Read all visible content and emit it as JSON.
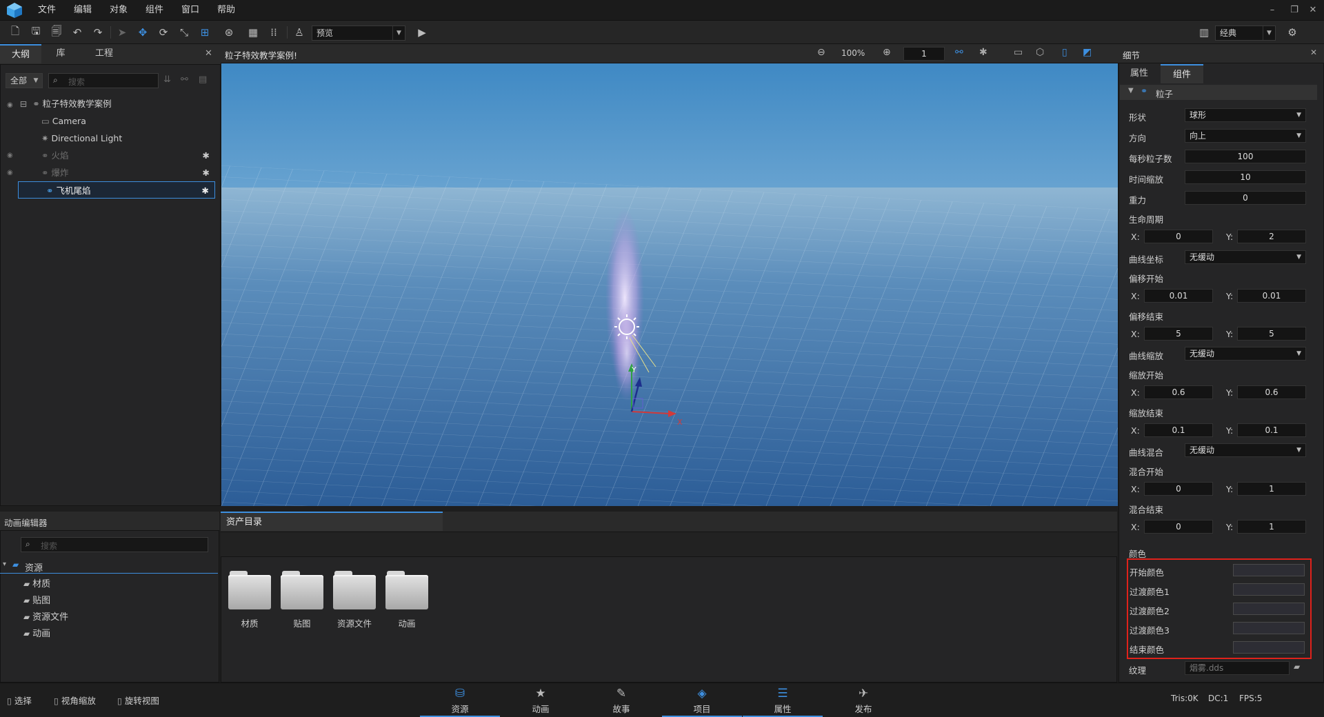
{
  "menu": [
    "文件",
    "编辑",
    "对象",
    "组件",
    "窗口",
    "帮助"
  ],
  "toolbar": {
    "view_mode": "预览",
    "layout": "经典"
  },
  "outline": {
    "tabs": [
      "大纲",
      "库",
      "工程"
    ],
    "filter": "全部",
    "search_placeholder": "搜索",
    "items": [
      {
        "label": "粒子特效教学案例"
      },
      {
        "label": "Camera"
      },
      {
        "label": "Directional Light"
      },
      {
        "label": "火焰"
      },
      {
        "label": "爆炸"
      },
      {
        "label": "飞机尾焰"
      }
    ]
  },
  "viewport": {
    "title": "粒子特效教学案例!",
    "zoom": "100%",
    "frame": "1"
  },
  "gizmo": {
    "x": "X",
    "y": "Y"
  },
  "anim_editor": {
    "title": "动画编辑器",
    "search_placeholder": "搜索",
    "root": "资源",
    "children": [
      "材质",
      "贴图",
      "资源文件",
      "动画"
    ]
  },
  "assets": {
    "tab": "资产目录",
    "folders": [
      "材质",
      "贴图",
      "资源文件",
      "动画"
    ]
  },
  "details": {
    "title": "细节",
    "tabs": [
      "属性",
      "组件"
    ],
    "section": "粒子",
    "shape_label": "形状",
    "shape_value": "球形",
    "direction_label": "方向",
    "direction_value": "向上",
    "rate_label": "每秒粒子数",
    "rate_value": "100",
    "timescale_label": "时间缩放",
    "timescale_value": "10",
    "gravity_label": "重力",
    "gravity_value": "0",
    "lifetime_label": "生命周期",
    "lifetime_x": "0",
    "lifetime_y": "2",
    "curve_coord_label": "曲线坐标",
    "curve_coord_value": "无缓动",
    "offset_start_label": "偏移开始",
    "offset_start_x": "0.01",
    "offset_start_y": "0.01",
    "offset_end_label": "偏移结束",
    "offset_end_x": "5",
    "offset_end_y": "5",
    "curve_scale_label": "曲线缩放",
    "curve_scale_value": "无缓动",
    "scale_start_label": "缩放开始",
    "scale_start_x": "0.6",
    "scale_start_y": "0.6",
    "scale_end_label": "缩放结束",
    "scale_end_x": "0.1",
    "scale_end_y": "0.1",
    "curve_blend_label": "曲线混合",
    "curve_blend_value": "无缓动",
    "blend_start_label": "混合开始",
    "blend_start_x": "0",
    "blend_start_y": "1",
    "blend_end_label": "混合结束",
    "blend_end_x": "0",
    "blend_end_y": "1",
    "x_label": "X:",
    "y_label": "Y:",
    "color_label": "颜色",
    "colors": [
      "开始颜色",
      "过渡颜色1",
      "过渡颜色2",
      "过渡颜色3",
      "结束颜色"
    ],
    "texture_label": "纹理",
    "texture_value": "烟雾.dds"
  },
  "status": {
    "select": "选择",
    "zoom": "视角缩放",
    "rotate": "旋转视图",
    "tris": "Tris:0K",
    "dc": "DC:1",
    "fps": "FPS:5"
  },
  "bottom_tabs": [
    "资源",
    "动画",
    "故事",
    "项目",
    "属性",
    "发布"
  ]
}
